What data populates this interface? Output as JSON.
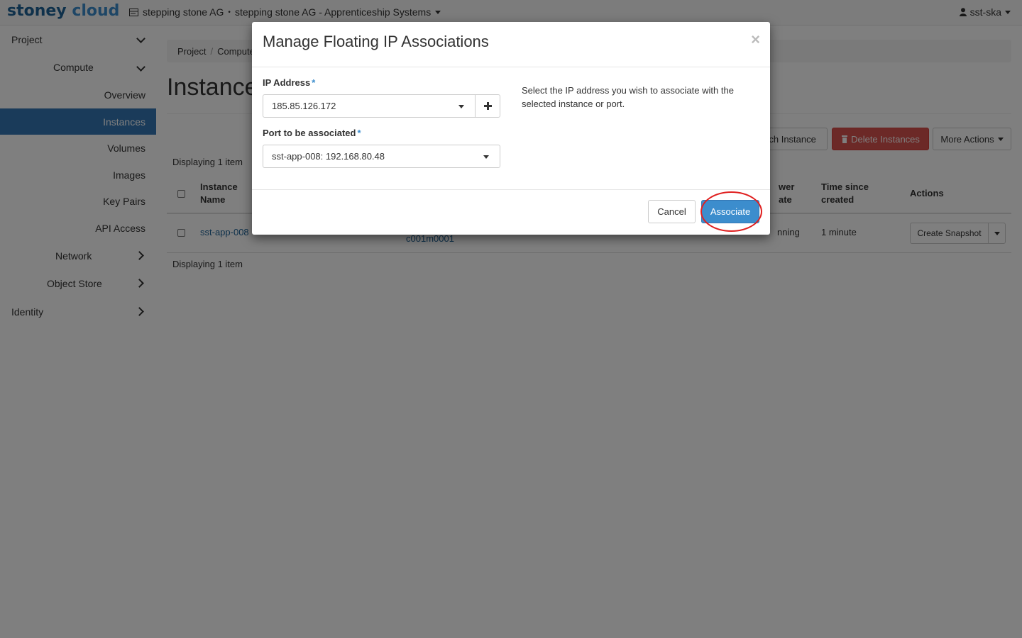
{
  "navbar": {
    "brand_part1": "stoney",
    "brand_part2": "cloud",
    "project": "stepping stone AG",
    "project_separator": "•",
    "project_detail": "stepping stone AG - Apprenticeship Systems",
    "user": "sst-ska"
  },
  "sidebar": {
    "project": "Project",
    "compute": "Compute",
    "items": [
      "Overview",
      "Instances",
      "Volumes",
      "Images",
      "Key Pairs",
      "API Access"
    ],
    "network": "Network",
    "object_store": "Object Store",
    "identity": "Identity",
    "active_item": "Instances"
  },
  "main": {
    "breadcrumb": [
      "Project",
      "Compute"
    ],
    "title": "Instances",
    "buttons": {
      "launch": "nch Instance",
      "delete": "Delete Instances",
      "more": "More Actions"
    },
    "display_count": "Displaying 1 item",
    "columns": {
      "instance_name": "Instance\nName",
      "power_state": "wer\nate",
      "time_since": "Time since\ncreated",
      "actions": "Actions"
    },
    "row": {
      "name": "sst-app-008",
      "host": "c001m0001",
      "power": "nning",
      "time": "1 minute",
      "action": "Create Snapshot"
    }
  },
  "modal": {
    "title": "Manage Floating IP Associations",
    "close": "×",
    "ip_label": "IP Address",
    "ip_value": "185.85.126.172",
    "port_label": "Port to be associated",
    "port_value": "sst-app-008: 192.168.80.48",
    "required_mark": "*",
    "help": "Select the IP address you wish to associate with the selected instance or port.",
    "cancel": "Cancel",
    "associate": "Associate"
  },
  "colors": {
    "brand_dark": "#1f6396",
    "brand_light": "#3c8dcd",
    "active_nav": "#3477b4",
    "danger": "#d9534f",
    "primary": "#3c8dcd",
    "highlight": "#e02020"
  }
}
